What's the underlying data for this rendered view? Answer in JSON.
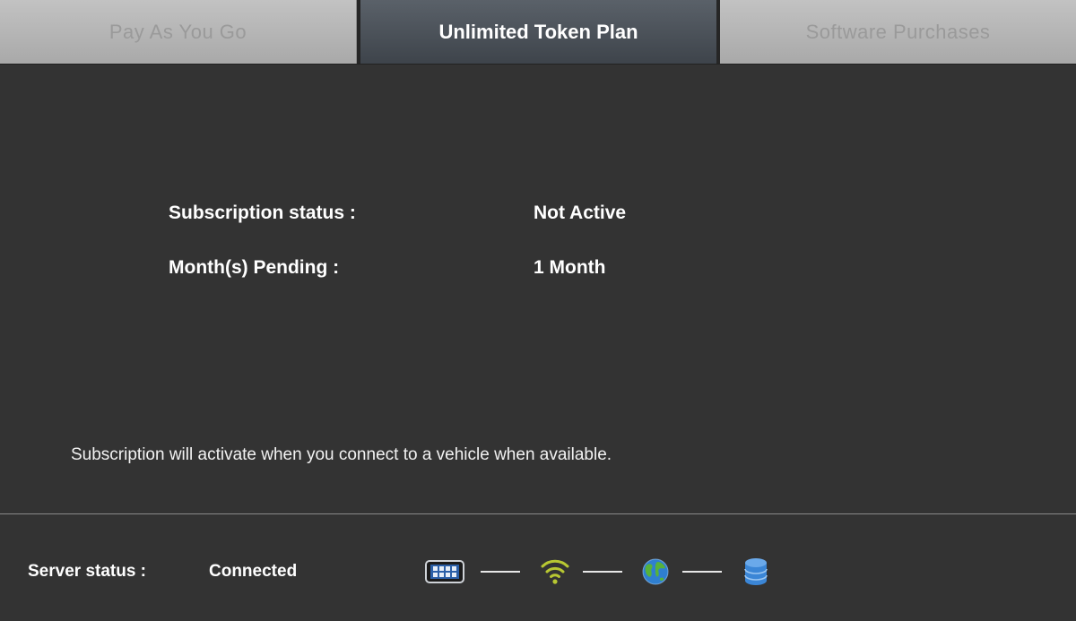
{
  "tabs": [
    {
      "label": "Pay As You Go",
      "active": false
    },
    {
      "label": "Unlimited Token Plan",
      "active": true
    },
    {
      "label": "Software Purchases",
      "active": false
    }
  ],
  "subscription": {
    "status_label": "Subscription status :",
    "status_value": "Not Active",
    "pending_label": "Month(s) Pending :",
    "pending_value": "1 Month"
  },
  "note": "Subscription will activate when you connect to a vehicle when available.",
  "server": {
    "label": "Server status :",
    "value": "Connected"
  },
  "connection_chain": {
    "icons": [
      "scan-tool-icon",
      "wifi-icon",
      "globe-icon",
      "database-icon"
    ],
    "colors": {
      "wifi": "#b8c832",
      "globe_ocean": "#2f7fd0",
      "globe_land": "#57b23a",
      "database": "#3b86d6",
      "device_screen": "#2a5fa8"
    }
  }
}
